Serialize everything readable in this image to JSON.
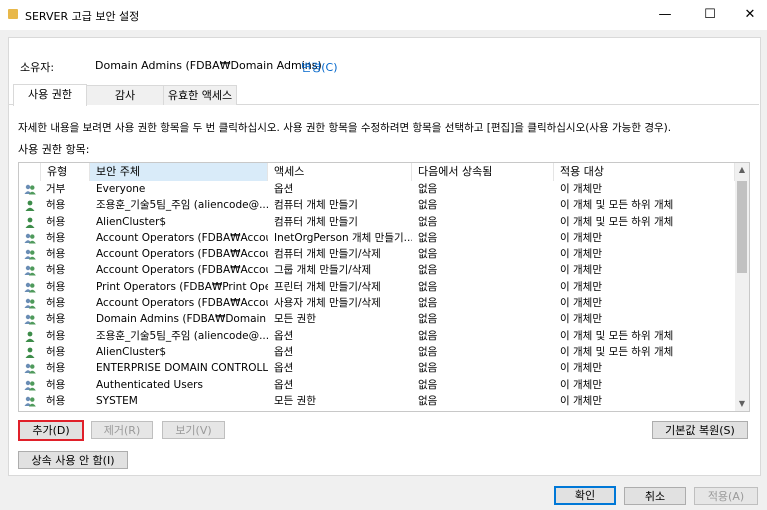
{
  "window": {
    "title": "SERVER 고급 보안 설정",
    "minimize": "—",
    "maximize": "☐",
    "close": "✕"
  },
  "owner": {
    "label": "소유자:",
    "value": "Domain Admins (FDBA₩Domain Admins)",
    "change_link": "변경(C)"
  },
  "tabs": [
    "사용 권한",
    "감사",
    "유효한 액세스"
  ],
  "instructions": "자세한 내용을 보려면 사용 권한 항목을 두 번 클릭하십시오. 사용 권한 항목을 수정하려면 항목을 선택하고 [편집]을 클릭하십시오(사용 가능한 경우).",
  "list_label": "사용 권한 항목:",
  "columns": [
    "유형",
    "보안 주체",
    "액세스",
    "다음에서 상속됨",
    "적용 대상"
  ],
  "rows": [
    {
      "icon": "group",
      "type": "거부",
      "principal": "Everyone",
      "access": "옵션",
      "inherited": "없음",
      "applies": "이 개체만"
    },
    {
      "icon": "user",
      "type": "허용",
      "principal": "조용훈_기술5팀_주임 (aliencode@...",
      "access": "컴퓨터 개체 만들기",
      "inherited": "없음",
      "applies": "이 개체 및 모든 하위 개체"
    },
    {
      "icon": "user",
      "type": "허용",
      "principal": "AlienCluster$",
      "access": "컴퓨터 개체 만들기",
      "inherited": "없음",
      "applies": "이 개체 및 모든 하위 개체"
    },
    {
      "icon": "group",
      "type": "허용",
      "principal": "Account Operators (FDBA₩Accou...",
      "access": "InetOrgPerson 개체 만들기...",
      "inherited": "없음",
      "applies": "이 개체만"
    },
    {
      "icon": "group",
      "type": "허용",
      "principal": "Account Operators (FDBA₩Accou...",
      "access": "컴퓨터 개체 만들기/삭제",
      "inherited": "없음",
      "applies": "이 개체만"
    },
    {
      "icon": "group",
      "type": "허용",
      "principal": "Account Operators (FDBA₩Accou...",
      "access": "그룹 개체 만들기/삭제",
      "inherited": "없음",
      "applies": "이 개체만"
    },
    {
      "icon": "group",
      "type": "허용",
      "principal": "Print Operators (FDBA₩Print Oper...",
      "access": "프린터 개체 만들기/삭제",
      "inherited": "없음",
      "applies": "이 개체만"
    },
    {
      "icon": "group",
      "type": "허용",
      "principal": "Account Operators (FDBA₩Accou...",
      "access": "사용자 개체 만들기/삭제",
      "inherited": "없음",
      "applies": "이 개체만"
    },
    {
      "icon": "group",
      "type": "허용",
      "principal": "Domain Admins (FDBA₩Domain ...",
      "access": "모든 권한",
      "inherited": "없음",
      "applies": "이 개체만"
    },
    {
      "icon": "user",
      "type": "허용",
      "principal": "조용훈_기술5팀_주임 (aliencode@...",
      "access": "옵션",
      "inherited": "없음",
      "applies": "이 개체 및 모든 하위 개체"
    },
    {
      "icon": "user",
      "type": "허용",
      "principal": "AlienCluster$",
      "access": "옵션",
      "inherited": "없음",
      "applies": "이 개체 및 모든 하위 개체"
    },
    {
      "icon": "group",
      "type": "허용",
      "principal": "ENTERPRISE DOMAIN CONTROLL...",
      "access": "옵션",
      "inherited": "없음",
      "applies": "이 개체만"
    },
    {
      "icon": "group",
      "type": "허용",
      "principal": "Authenticated Users",
      "access": "옵션",
      "inherited": "없음",
      "applies": "이 개체만"
    },
    {
      "icon": "group",
      "type": "허용",
      "principal": "SYSTEM",
      "access": "모든 권한",
      "inherited": "없음",
      "applies": "이 개체만"
    }
  ],
  "buttons": {
    "add": "추가(D)",
    "remove": "제거(R)",
    "view": "보기(V)",
    "restore_defaults": "기본값 복원(S)",
    "disable_inheritance": "상속 사용 안 함(I)",
    "ok": "확인",
    "cancel": "취소",
    "apply": "적용(A)"
  },
  "colors": {
    "accent": "#0078d7",
    "highlight_box": "#e0202a",
    "sorted_header": "#d9ebf9",
    "link": "#0066cc"
  }
}
